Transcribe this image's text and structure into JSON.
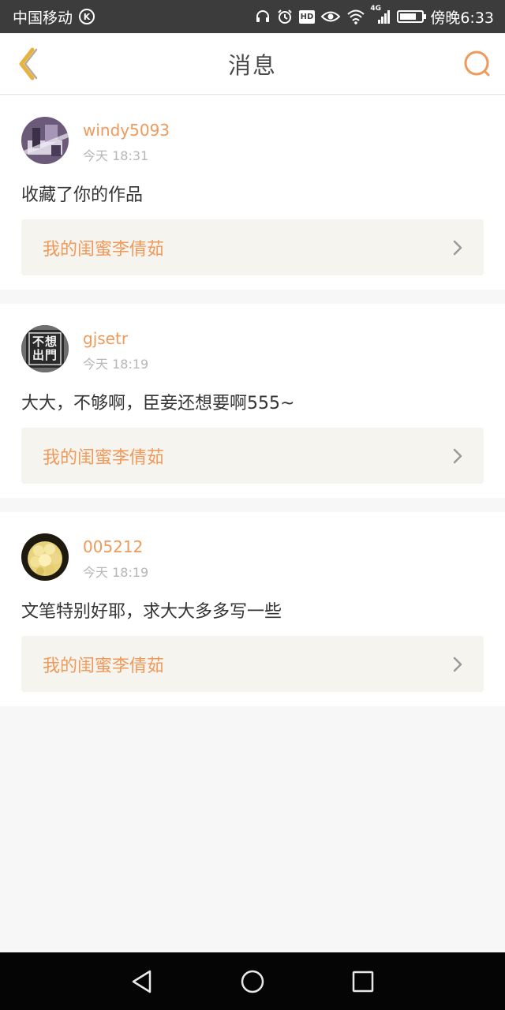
{
  "status_bar": {
    "carrier": "中国移动",
    "carrier_badge": "K",
    "hd_badge": "HD",
    "network": "4G",
    "time_label": "傍晚6:33",
    "battery_level": 0.75
  },
  "nav": {
    "title": "消息",
    "back_icon": "chevron-left-icon",
    "search_icon": "search-icon"
  },
  "colors": {
    "accent": "#ef9a5a",
    "back_icon": "#e8b33d",
    "card_box": "#f5f4ef",
    "status_bar": "#3c3c3c"
  },
  "messages": [
    {
      "username": "windy5093",
      "time": "今天 18:31",
      "text": "收藏了你的作品",
      "work_title": "我的闺蜜李倩茹"
    },
    {
      "username": "gjsetr",
      "time": "今天 18:19",
      "text": "大大，不够啊，臣妾还想要啊555~",
      "work_title": "我的闺蜜李倩茹",
      "avatar_text": "不想出門"
    },
    {
      "username": "005212",
      "time": "今天 18:19",
      "text": "文笔特别好耶，求大大多多写一些",
      "work_title": "我的闺蜜李倩茹"
    }
  ]
}
